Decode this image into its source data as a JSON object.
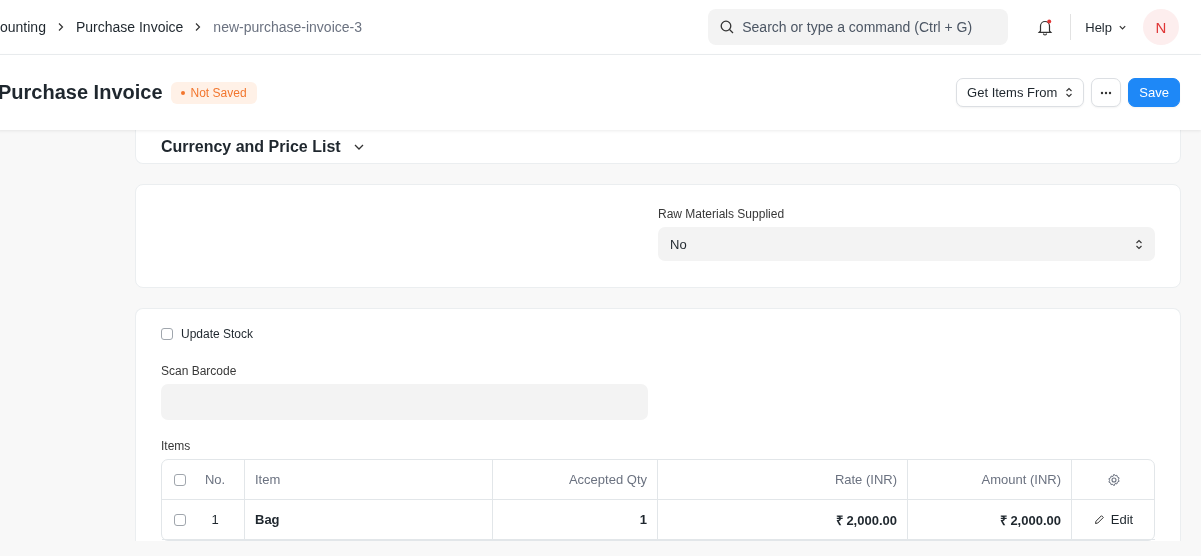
{
  "breadcrumbs": [
    {
      "label": "ounting",
      "current": false
    },
    {
      "label": "Purchase Invoice",
      "current": false
    },
    {
      "label": "new-purchase-invoice-3",
      "current": true
    }
  ],
  "search": {
    "placeholder": "Search or type a command (Ctrl + G)"
  },
  "notifications": {
    "unread": true
  },
  "help_menu": "Help",
  "avatar": "N",
  "page": {
    "title": "Purchase Invoice",
    "status": "Not Saved",
    "buttons": [
      {
        "label": "Get Items From",
        "kind": "dropdown"
      },
      {
        "kind": "more"
      },
      {
        "label": "Save",
        "kind": "primary"
      }
    ]
  },
  "currency_section": {
    "title": "Currency and Price List",
    "expanded": false
  },
  "raw_materials": {
    "label": "Raw Materials Supplied",
    "value": "No"
  },
  "update_stock": {
    "label": "Update Stock",
    "checked": false
  },
  "scan_barcode": {
    "label": "Scan Barcode"
  },
  "items": {
    "label": "Items",
    "all_selected": false,
    "columns": [
      "No.",
      "Item",
      "Accepted Qty",
      "Rate (INR)",
      "Amount (INR)"
    ],
    "rows": [
      {
        "no": "1",
        "item": "Bag",
        "qty": "1",
        "rate": "₹ 2,000.00",
        "amount": "₹ 2,000.00",
        "selected": false,
        "action": "Edit"
      }
    ]
  }
}
